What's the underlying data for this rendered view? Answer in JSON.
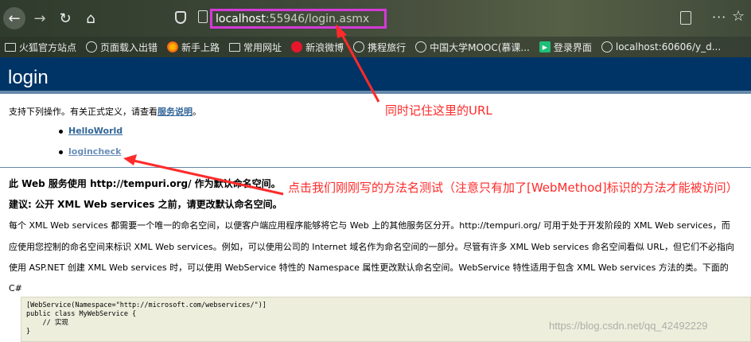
{
  "browser": {
    "url_host": "localhost",
    "url_rest": ":55946/login.asmx",
    "bookmarks": [
      {
        "icon": "folder-icon",
        "label": "火狐官方站点"
      },
      {
        "icon": "globe-icon",
        "label": "页面载入出错"
      },
      {
        "icon": "firefox-icon",
        "label": "新手上路"
      },
      {
        "icon": "folder-icon",
        "label": "常用网址"
      },
      {
        "icon": "weibo-icon",
        "label": "新浪微博"
      },
      {
        "icon": "globe-icon",
        "label": "携程旅行"
      },
      {
        "icon": "globe-icon",
        "label": "中国大学MOOC(慕课..."
      },
      {
        "icon": "play-icon",
        "label": "登录界面"
      },
      {
        "icon": "globe-icon",
        "label": "localhost:60606/y_d..."
      }
    ]
  },
  "page": {
    "title": "login",
    "intro_text": "支持下列操作。有关正式定义，请查看",
    "intro_link": "服务说明",
    "intro_end": "。",
    "operations": [
      "HelloWorld",
      "logincheck"
    ],
    "ns_line1": "此 Web 服务使用 http://tempuri.org/ 作为默认命名空间。",
    "ns_line2": "建议: 公开 XML Web services 之前，请更改默认命名空间。",
    "para1": "每个 XML Web services 都需要一个唯一的命名空间，以便客户端应用程序能够将它与 Web 上的其他服务区分开。http://tempuri.org/ 可用于处于开发阶段的 XML Web services，而",
    "para2": "应使用您控制的命名空间来标识 XML Web services。例如，可以使用公司的 Internet 域名作为命名空间的一部分。尽管有许多 XML Web services 命名空间看似 URL，但它们不必指向",
    "para3": "使用 ASP.NET 创建 XML Web services 时，可以使用 WebService 特性的 Namespace 属性更改默认命名空间。WebService 特性适用于包含 XML Web services 方法的类。下面的",
    "lang_label": "C#",
    "code": "[WebService(Namespace=\"http://microsoft.com/webservices/\")]\npublic class MyWebService {\n    // 实现\n}"
  },
  "annotations": {
    "note1": "同时记住这里的URL",
    "note2": "点击我们刚刚写的方法名测试（注意只有加了[WebMethod]标识的方法才能被访问）"
  },
  "watermark": "https://blog.csdn.net/qq_42492229",
  "colors": {
    "header_bg": "#003366",
    "link": "#336699",
    "url_highlight": "#d33ad8",
    "annotation": "#ff2a2a",
    "code_bg": "#eeeedd"
  }
}
